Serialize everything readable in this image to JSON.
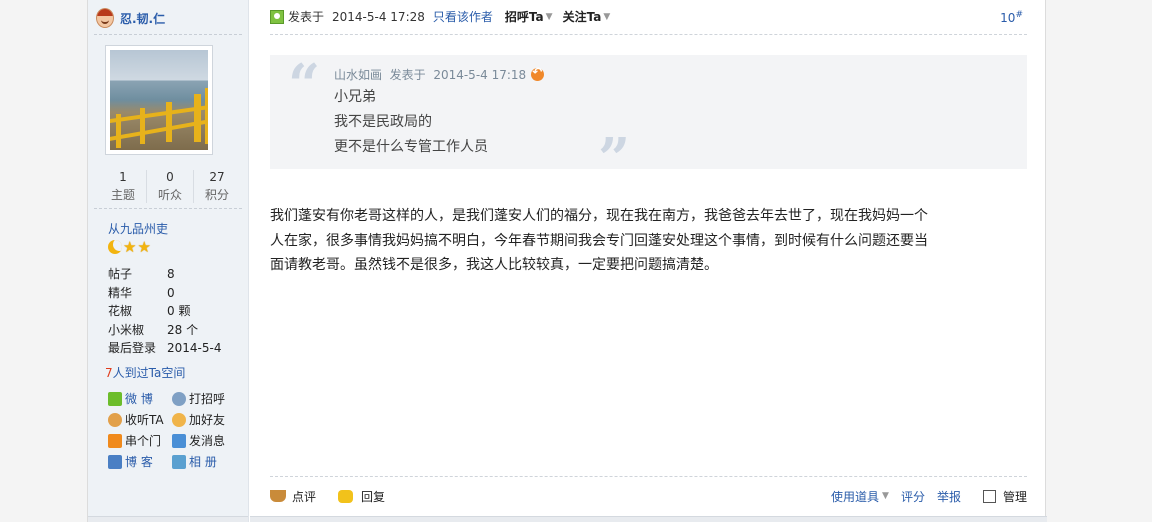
{
  "user": {
    "name": "忍.韧.仁",
    "stats": [
      {
        "value": "1",
        "label": "主题"
      },
      {
        "value": "0",
        "label": "听众"
      },
      {
        "value": "27",
        "label": "积分"
      }
    ],
    "group": "从九品州吏",
    "info": [
      {
        "label": "帖子",
        "value": "8"
      },
      {
        "label": "精华",
        "value": "0"
      },
      {
        "label": "花椒",
        "value": "0 颗"
      },
      {
        "label": "小米椒",
        "value": "28 个"
      },
      {
        "label": "最后登录",
        "value": "2014-5-4"
      }
    ],
    "visits_num": "7",
    "visits_text": "人到过Ta空间",
    "actions": [
      {
        "label": "微  博",
        "icon": "star-icon"
      },
      {
        "label": "打招呼",
        "icon": "wave-icon"
      },
      {
        "label": "收听TA",
        "icon": "listen-icon"
      },
      {
        "label": "加好友",
        "icon": "add-friend-icon"
      },
      {
        "label": "串个门",
        "icon": "home-icon"
      },
      {
        "label": "发消息",
        "icon": "mail-icon"
      },
      {
        "label": "博  客",
        "icon": "blog-icon"
      },
      {
        "label": "相  册",
        "icon": "album-icon"
      }
    ]
  },
  "post": {
    "posted_label": "发表于",
    "posted_time": "2014-5-4 17:28",
    "only_author": "只看该作者",
    "greet": "招呼Ta",
    "follow": "关注Ta",
    "floor": "10",
    "floor_sup": "#",
    "quote": {
      "author": "山水如画",
      "posted": "发表于",
      "time": "2014-5-4 17:18",
      "lines": [
        "小兄弟",
        "我不是民政局的",
        "更不是什么专管工作人员"
      ]
    },
    "body_lines": [
      "我们蓬安有你老哥这样的人，是我们蓬安人们的福分，现在我在南方，我爸爸去年去世了，现在我妈妈一个",
      "人在家，很多事情我妈妈搞不明白，今年春节期间我会专门回蓬安处理这个事情，到时候有什么问题还要当",
      "面请教老哥。虽然钱不是很多，我这人比较较真，一定要把问题搞清楚。"
    ],
    "footer": {
      "comment": "点评",
      "reply": "回复",
      "tools": "使用道具",
      "rate": "评分",
      "report": "举报",
      "manage": "管理"
    }
  },
  "colors": {
    "link": "#2a5caa",
    "accent": "#f2b40f",
    "sidebar_bg": "#eef2f6"
  }
}
